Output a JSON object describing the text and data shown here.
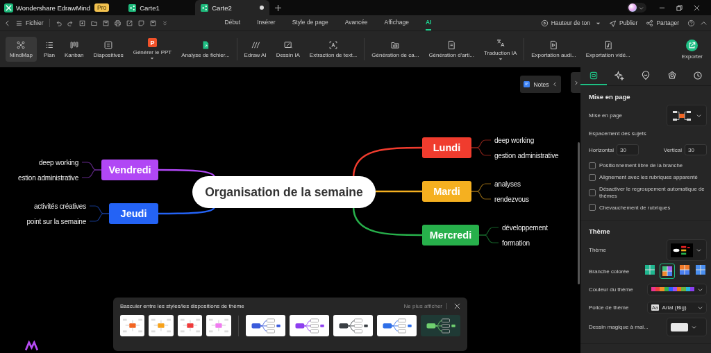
{
  "titlebar": {
    "app_name": "Wondershare EdrawMind",
    "badge": "Pro",
    "tabs": [
      {
        "label": "Carte1",
        "selected": false,
        "unsaved": false
      },
      {
        "label": "Carte2",
        "selected": true,
        "unsaved": true
      }
    ]
  },
  "menubar": {
    "file": "Fichier",
    "tabs": [
      {
        "label": "Début",
        "selected": false
      },
      {
        "label": "Insérer",
        "selected": false
      },
      {
        "label": "Style de page",
        "selected": false
      },
      {
        "label": "Avancée",
        "selected": false
      },
      {
        "label": "Affichage",
        "selected": false
      },
      {
        "label": "AI",
        "selected": true
      }
    ],
    "actions": [
      {
        "label": "Hauteur de ton",
        "dropdown": true
      },
      {
        "label": "Publier"
      },
      {
        "label": "Partager"
      }
    ]
  },
  "ribbon": {
    "groups": [
      [
        {
          "label": "MindMap",
          "selected": true
        },
        {
          "label": "Plan",
          "selected": false
        },
        {
          "label": "Kanban",
          "selected": false
        },
        {
          "label": "Diapositives",
          "selected": false
        },
        {
          "label": "Générer le PPT",
          "glyph": "P",
          "selected": false,
          "dropdown": true
        },
        {
          "label": "Analyse de fichier...",
          "selected": false
        }
      ],
      [
        {
          "label": "Edraw AI",
          "selected": false
        },
        {
          "label": "Dessin IA",
          "selected": false
        },
        {
          "label": "Extraction de text...",
          "selected": false
        }
      ],
      [
        {
          "label": "Génération de ca...",
          "selected": false
        },
        {
          "label": "Génération d'arti...",
          "selected": false
        },
        {
          "label": "Traduction IA",
          "selected": false,
          "dropdown": true
        }
      ],
      [
        {
          "label": "Exportation audi...",
          "selected": false
        },
        {
          "label": "Exportation vidé...",
          "selected": false
        }
      ]
    ],
    "export": "Exporter"
  },
  "canvas": {
    "notes": "Notes",
    "central": "Organisation de la semaine",
    "branches": [
      {
        "label": "Lundi",
        "color": "#f03c2e",
        "children": [
          {
            "text": "deep working"
          },
          {
            "text": "gestion administrative"
          }
        ]
      },
      {
        "label": "Mardi",
        "color": "#f5b020",
        "children": [
          {
            "text": "analyses"
          },
          {
            "text": "rendezvous"
          }
        ]
      },
      {
        "label": "Mercredi",
        "color": "#27b04b",
        "children": [
          {
            "text": "développement"
          },
          {
            "text": "formation"
          }
        ]
      },
      {
        "label": "Vendredi",
        "color": "#b147f5",
        "children": [
          {
            "text": "deep working"
          },
          {
            "text": "estion administrative"
          }
        ]
      },
      {
        "label": "Jeudi",
        "color": "#2463f5",
        "children": [
          {
            "text": "activités créatives"
          },
          {
            "text": "point sur la semaine"
          }
        ]
      }
    ]
  },
  "theme_switcher": {
    "title": "Basculer entre les styles/les dispositions de thème",
    "dismiss": "Ne plus afficher",
    "thumbnails": [
      {
        "kind": "style",
        "selected": false
      },
      {
        "kind": "style",
        "selected": false
      },
      {
        "kind": "style",
        "selected": false
      },
      {
        "kind": "style",
        "selected": false
      },
      {
        "kind": "layout",
        "selected": false
      },
      {
        "kind": "layout",
        "selected": false
      },
      {
        "kind": "layout",
        "selected": false
      },
      {
        "kind": "layout",
        "selected": false
      },
      {
        "kind": "layout",
        "selected": true
      }
    ]
  },
  "panel": {
    "tabs": [
      {
        "selected": true
      },
      {
        "selected": false
      },
      {
        "selected": false
      },
      {
        "selected": false
      },
      {
        "selected": false
      }
    ],
    "layout_section": {
      "title": "Mise en page",
      "layout_label": "Mise en page",
      "spacing_label": "Espacement des sujets",
      "horizontal": {
        "label": "Horizontal",
        "value": "30"
      },
      "vertical": {
        "label": "Vertical",
        "value": "30"
      },
      "options": [
        {
          "label": "Positionnement libre de la branche",
          "checked": false
        },
        {
          "label": "Alignement avec les rubriques apparenté",
          "checked": false
        },
        {
          "label": "Désactiver le regroupement automatique de thèmes",
          "checked": false
        },
        {
          "label": "Chevauchement de rubriques",
          "checked": false
        }
      ]
    },
    "theme_section": {
      "title": "Thème",
      "theme_label": "Thème",
      "branch_label": "Branche colorée",
      "branch_styles": [
        {
          "selected": false
        },
        {
          "selected": true
        },
        {
          "selected": false
        },
        {
          "selected": false
        }
      ],
      "color_label": "Couleur du thème",
      "palette": [
        {
          "color": "#e8358f"
        },
        {
          "color": "#ef4040"
        },
        {
          "color": "#f28c28"
        },
        {
          "color": "#2fb24c"
        },
        {
          "color": "#2962ff"
        },
        {
          "color": "#a24ff0"
        },
        {
          "color": "#f27420"
        },
        {
          "color": "#6cb33f"
        },
        {
          "color": "#22b8e0"
        },
        {
          "color": "#8a3ff0"
        }
      ],
      "font_label": "Police de thème",
      "font_badge": "Aa",
      "font": "Arial (Big)",
      "magic_label": "Dessin magique à mai..."
    }
  }
}
